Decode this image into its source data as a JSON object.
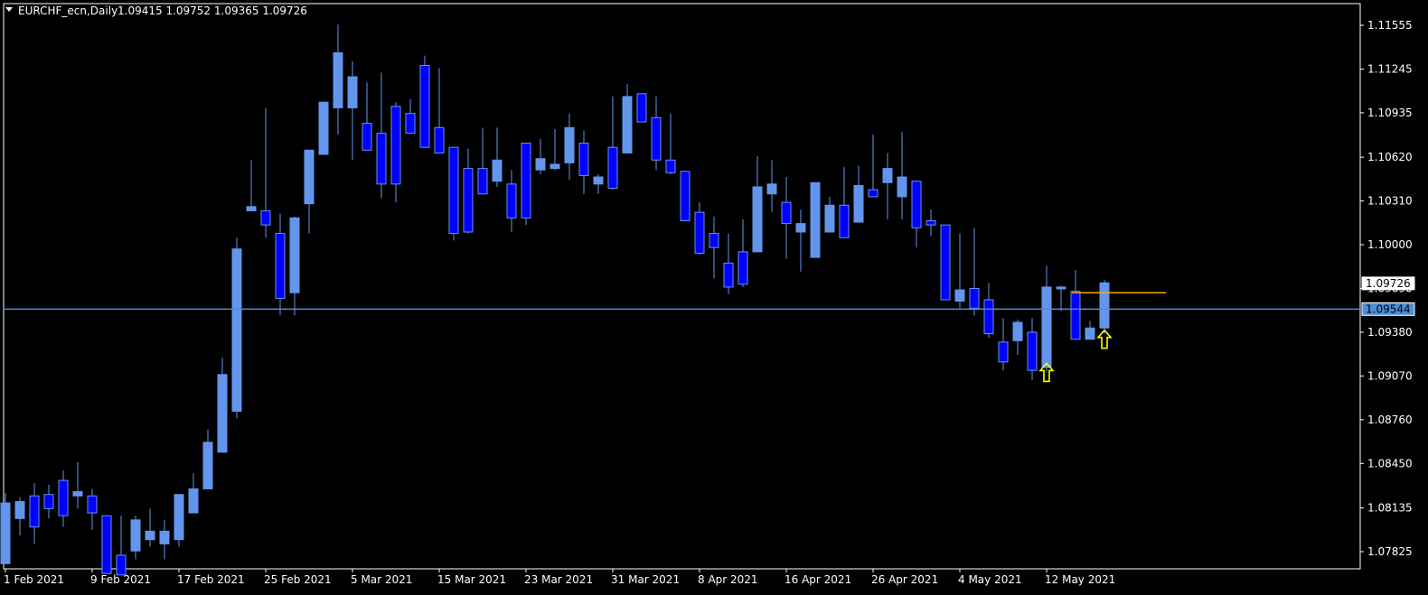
{
  "header": {
    "symbol_label": "EURCHF_ecn,Daily",
    "ohlc_label": "1.09415 1.09752 1.09365 1.09726"
  },
  "colors": {
    "background": "#000000",
    "bull_candle": "#6495ED",
    "bear_candle": "#0000FF",
    "wick": "#6495ED",
    "axis": "#FFFFFF",
    "hline": "#4F8FD6",
    "orange_line": "#FFA500",
    "arrow": "#FFFF00"
  },
  "chart_data": {
    "type": "candlestick",
    "symbol": "EURCHF_ecn",
    "timeframe": "Daily",
    "y_ticks": [
      1.11555,
      1.11245,
      1.10935,
      1.1062,
      1.1031,
      1.1,
      1.0969,
      1.0938,
      1.0907,
      1.0876,
      1.0845,
      1.08135,
      1.07825
    ],
    "y_tick_labels": [
      "1.11555",
      "1.11245",
      "1.10935",
      "1.10620",
      "1.10310",
      "1.10000",
      "1.09690",
      "1.09380",
      "1.09070",
      "1.08760",
      "1.08450",
      "1.08135",
      "1.07825"
    ],
    "x_labels": [
      {
        "label": "1 Feb 2021",
        "index": 0
      },
      {
        "label": "9 Feb 2021",
        "index": 6
      },
      {
        "label": "17 Feb 2021",
        "index": 12
      },
      {
        "label": "25 Feb 2021",
        "index": 18
      },
      {
        "label": "5 Mar 2021",
        "index": 24
      },
      {
        "label": "15 Mar 2021",
        "index": 30
      },
      {
        "label": "23 Mar 2021",
        "index": 36
      },
      {
        "label": "31 Mar 2021",
        "index": 42
      },
      {
        "label": "8 Apr 2021",
        "index": 48
      },
      {
        "label": "16 Apr 2021",
        "index": 54
      },
      {
        "label": "26 Apr 2021",
        "index": 60
      },
      {
        "label": "4 May 2021",
        "index": 66
      },
      {
        "label": "12 May 2021",
        "index": 72
      }
    ],
    "candles": [
      {
        "o": 1.0774,
        "h": 1.0824,
        "l": 1.0774,
        "c": 1.0817
      },
      {
        "o": 1.0806,
        "h": 1.0821,
        "l": 1.0794,
        "c": 1.0818
      },
      {
        "o": 1.0822,
        "h": 1.0831,
        "l": 1.0788,
        "c": 1.08
      },
      {
        "o": 1.0823,
        "h": 1.083,
        "l": 1.0806,
        "c": 1.0813
      },
      {
        "o": 1.0833,
        "h": 1.084,
        "l": 1.08,
        "c": 1.0808
      },
      {
        "o": 1.0822,
        "h": 1.0846,
        "l": 1.0813,
        "c": 1.0825
      },
      {
        "o": 1.0822,
        "h": 1.0827,
        "l": 1.0798,
        "c": 1.081
      },
      {
        "o": 1.0808,
        "h": 1.0808,
        "l": 1.0767,
        "c": 1.0767
      },
      {
        "o": 1.078,
        "h": 1.0808,
        "l": 1.0766,
        "c": 1.0766
      },
      {
        "o": 1.0783,
        "h": 1.0808,
        "l": 1.0777,
        "c": 1.0805
      },
      {
        "o": 1.0791,
        "h": 1.0813,
        "l": 1.0786,
        "c": 1.0797
      },
      {
        "o": 1.0788,
        "h": 1.0805,
        "l": 1.0777,
        "c": 1.0797
      },
      {
        "o": 1.0791,
        "h": 1.0821,
        "l": 1.0786,
        "c": 1.0823
      },
      {
        "o": 1.081,
        "h": 1.0838,
        "l": 1.081,
        "c": 1.0827
      },
      {
        "o": 1.0827,
        "h": 1.0869,
        "l": 1.0827,
        "c": 1.086
      },
      {
        "o": 1.0853,
        "h": 1.092,
        "l": 1.0853,
        "c": 1.0908
      },
      {
        "o": 1.0882,
        "h": 1.1005,
        "l": 1.0877,
        "c": 1.0997
      },
      {
        "o": 1.1024,
        "h": 1.106,
        "l": 1.1024,
        "c": 1.1027
      },
      {
        "o": 1.1024,
        "h": 1.1097,
        "l": 1.1005,
        "c": 1.1014
      },
      {
        "o": 1.1008,
        "h": 1.1022,
        "l": 1.095,
        "c": 1.0962
      },
      {
        "o": 1.0966,
        "h": 1.102,
        "l": 1.095,
        "c": 1.1019
      },
      {
        "o": 1.1029,
        "h": 1.1063,
        "l": 1.1008,
        "c": 1.1067
      },
      {
        "o": 1.1064,
        "h": 1.1095,
        "l": 1.1064,
        "c": 1.1101
      },
      {
        "o": 1.1097,
        "h": 1.1156,
        "l": 1.1078,
        "c": 1.1136
      },
      {
        "o": 1.1097,
        "h": 1.113,
        "l": 1.106,
        "c": 1.1119
      },
      {
        "o": 1.1086,
        "h": 1.1115,
        "l": 1.108,
        "c": 1.1067
      },
      {
        "o": 1.1079,
        "h": 1.1122,
        "l": 1.1033,
        "c": 1.1043
      },
      {
        "o": 1.1098,
        "h": 1.1101,
        "l": 1.103,
        "c": 1.1043
      },
      {
        "o": 1.1093,
        "h": 1.1103,
        "l": 1.1083,
        "c": 1.1079
      },
      {
        "o": 1.1127,
        "h": 1.1134,
        "l": 1.1069,
        "c": 1.1069
      },
      {
        "o": 1.1083,
        "h": 1.1125,
        "l": 1.1065,
        "c": 1.1065
      },
      {
        "o": 1.1069,
        "h": 1.1069,
        "l": 1.1003,
        "c": 1.1008
      },
      {
        "o": 1.1054,
        "h": 1.1068,
        "l": 1.1008,
        "c": 1.1009
      },
      {
        "o": 1.1054,
        "h": 1.1083,
        "l": 1.1051,
        "c": 1.1036
      },
      {
        "o": 1.1045,
        "h": 1.1083,
        "l": 1.1041,
        "c": 1.106
      },
      {
        "o": 1.1043,
        "h": 1.1053,
        "l": 1.1009,
        "c": 1.1019
      },
      {
        "o": 1.1072,
        "h": 1.1072,
        "l": 1.1014,
        "c": 1.1019
      },
      {
        "o": 1.1053,
        "h": 1.1075,
        "l": 1.105,
        "c": 1.1061
      },
      {
        "o": 1.1054,
        "h": 1.1082,
        "l": 1.1053,
        "c": 1.1057
      },
      {
        "o": 1.1058,
        "h": 1.1093,
        "l": 1.1046,
        "c": 1.1083
      },
      {
        "o": 1.1072,
        "h": 1.1081,
        "l": 1.1036,
        "c": 1.1049
      },
      {
        "o": 1.1043,
        "h": 1.105,
        "l": 1.1036,
        "c": 1.1048
      },
      {
        "o": 1.1069,
        "h": 1.1105,
        "l": 1.1039,
        "c": 1.104
      },
      {
        "o": 1.1065,
        "h": 1.1114,
        "l": 1.1065,
        "c": 1.1105
      },
      {
        "o": 1.1107,
        "h": 1.1107,
        "l": 1.1087,
        "c": 1.1087
      },
      {
        "o": 1.109,
        "h": 1.1105,
        "l": 1.1053,
        "c": 1.106
      },
      {
        "o": 1.106,
        "h": 1.1093,
        "l": 1.105,
        "c": 1.1051
      },
      {
        "o": 1.1052,
        "h": 1.1052,
        "l": 1.1017,
        "c": 1.1017
      },
      {
        "o": 1.1023,
        "h": 1.103,
        "l": 1.0993,
        "c": 1.0994
      },
      {
        "o": 1.1008,
        "h": 1.102,
        "l": 1.0976,
        "c": 1.0998
      },
      {
        "o": 1.0987,
        "h": 1.1008,
        "l": 1.0965,
        "c": 1.097
      },
      {
        "o": 1.0995,
        "h": 1.1018,
        "l": 1.097,
        "c": 1.0972
      },
      {
        "o": 1.0995,
        "h": 1.1063,
        "l": 1.0995,
        "c": 1.1041
      },
      {
        "o": 1.1036,
        "h": 1.106,
        "l": 1.1023,
        "c": 1.1043
      },
      {
        "o": 1.103,
        "h": 1.1048,
        "l": 1.099,
        "c": 1.1015
      },
      {
        "o": 1.1009,
        "h": 1.1025,
        "l": 1.0981,
        "c": 1.1015
      },
      {
        "o": 1.0991,
        "h": 1.1036,
        "l": 1.0991,
        "c": 1.1044
      },
      {
        "o": 1.1009,
        "h": 1.1034,
        "l": 1.1019,
        "c": 1.1028
      },
      {
        "o": 1.1028,
        "h": 1.1055,
        "l": 1.1017,
        "c": 1.1005
      },
      {
        "o": 1.1016,
        "h": 1.1056,
        "l": 1.1016,
        "c": 1.1042
      },
      {
        "o": 1.1039,
        "h": 1.1078,
        "l": 1.1038,
        "c": 1.1034
      },
      {
        "o": 1.1044,
        "h": 1.1065,
        "l": 1.1018,
        "c": 1.1054
      },
      {
        "o": 1.1034,
        "h": 1.108,
        "l": 1.1018,
        "c": 1.1048
      },
      {
        "o": 1.1045,
        "h": 1.1045,
        "l": 1.0998,
        "c": 1.1012
      },
      {
        "o": 1.1017,
        "h": 1.1025,
        "l": 1.1006,
        "c": 1.1014
      },
      {
        "o": 1.1014,
        "h": 1.1014,
        "l": 1.0965,
        "c": 1.0961
      },
      {
        "o": 1.096,
        "h": 1.1008,
        "l": 1.0955,
        "c": 1.0968
      },
      {
        "o": 1.0969,
        "h": 1.1012,
        "l": 1.095,
        "c": 1.0955
      },
      {
        "o": 1.0961,
        "h": 1.0973,
        "l": 1.0934,
        "c": 1.0937
      },
      {
        "o": 1.0931,
        "h": 1.0948,
        "l": 1.0911,
        "c": 1.0917
      },
      {
        "o": 1.0932,
        "h": 1.0947,
        "l": 1.0922,
        "c": 1.0945
      },
      {
        "o": 1.0938,
        "h": 1.0948,
        "l": 1.0904,
        "c": 1.0911
      },
      {
        "o": 1.0913,
        "h": 1.0985,
        "l": 1.091,
        "c": 1.097
      },
      {
        "o": 1.0969,
        "h": 1.0971,
        "l": 1.0953,
        "c": 1.097
      },
      {
        "o": 1.0967,
        "h": 1.0982,
        "l": 1.0933,
        "c": 1.0933
      },
      {
        "o": 1.0933,
        "h": 1.0946,
        "l": 1.0934,
        "c": 1.0941
      },
      {
        "o": 1.0941,
        "h": 1.0975,
        "l": 1.0937,
        "c": 1.0973
      }
    ],
    "horizontal_line": {
      "price": 1.09544,
      "label": "1.09544"
    },
    "current_price": {
      "price": 1.09726,
      "label": "1.09726"
    },
    "orange_level": {
      "price": 1.0966,
      "from_index": 74,
      "to_index": 80
    },
    "arrows": [
      {
        "index": 72,
        "price": 1.0907,
        "direction": "up"
      },
      {
        "index": 76,
        "price": 1.09305,
        "direction": "up"
      }
    ],
    "ylim": [
      1.07825,
      1.11555
    ]
  }
}
